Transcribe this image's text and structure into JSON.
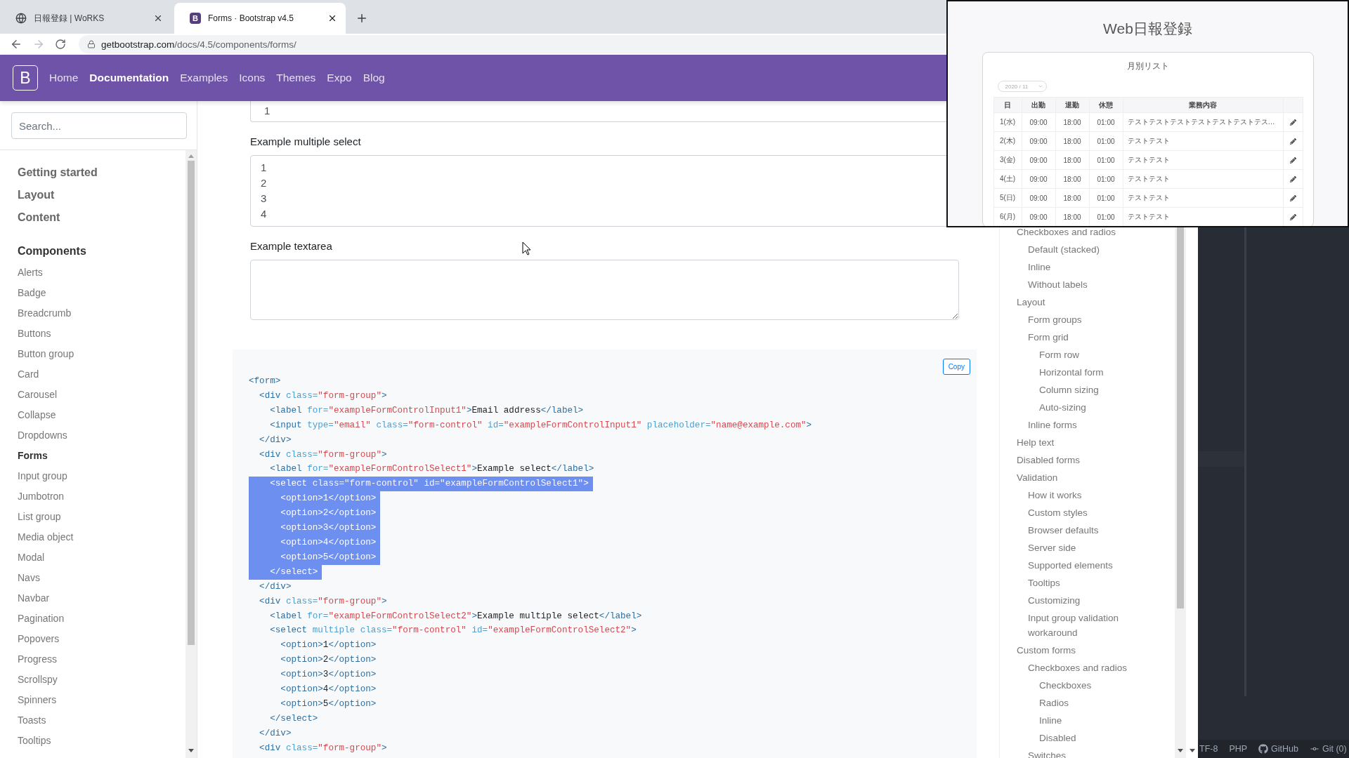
{
  "browser": {
    "tabs": [
      {
        "title": "日報登録 | WoRKS",
        "selected": false,
        "favicon": {
          "kind": "globe"
        }
      },
      {
        "title": "Forms · Bootstrap v4.5",
        "selected": true,
        "favicon": {
          "kind": "brand",
          "letter": "B"
        }
      }
    ],
    "back_disabled": false,
    "forward_disabled": true,
    "url": {
      "host": "getbootstrap.com",
      "path": "/docs/4.5/components/forms/"
    }
  },
  "navbar": {
    "brand": "B",
    "links": [
      {
        "label": "Home",
        "selected": false
      },
      {
        "label": "Documentation",
        "selected": true
      },
      {
        "label": "Examples",
        "selected": false
      },
      {
        "label": "Icons",
        "selected": false
      },
      {
        "label": "Themes",
        "selected": false
      },
      {
        "label": "Expo",
        "selected": false
      },
      {
        "label": "Blog",
        "selected": false
      }
    ]
  },
  "sidebar": {
    "search": {
      "placeholder": "Search..."
    },
    "items": [
      {
        "label": "Getting started",
        "expanded": false
      },
      {
        "label": "Layout",
        "expanded": false
      },
      {
        "label": "Content",
        "expanded": false
      },
      {
        "label": "Components",
        "expanded": true,
        "children": [
          {
            "label": "Alerts",
            "selected": false
          },
          {
            "label": "Badge",
            "selected": false
          },
          {
            "label": "Breadcrumb",
            "selected": false
          },
          {
            "label": "Buttons",
            "selected": false
          },
          {
            "label": "Button group",
            "selected": false
          },
          {
            "label": "Card",
            "selected": false
          },
          {
            "label": "Carousel",
            "selected": false
          },
          {
            "label": "Collapse",
            "selected": false
          },
          {
            "label": "Dropdowns",
            "selected": false
          },
          {
            "label": "Forms",
            "selected": true
          },
          {
            "label": "Input group",
            "selected": false
          },
          {
            "label": "Jumbotron",
            "selected": false
          },
          {
            "label": "List group",
            "selected": false
          },
          {
            "label": "Media object",
            "selected": false
          },
          {
            "label": "Modal",
            "selected": false
          },
          {
            "label": "Navs",
            "selected": false
          },
          {
            "label": "Navbar",
            "selected": false
          },
          {
            "label": "Pagination",
            "selected": false
          },
          {
            "label": "Popovers",
            "selected": false
          },
          {
            "label": "Progress",
            "selected": false
          },
          {
            "label": "Scrollspy",
            "selected": false
          },
          {
            "label": "Spinners",
            "selected": false
          },
          {
            "label": "Toasts",
            "selected": false
          },
          {
            "label": "Tooltips",
            "selected": false
          }
        ]
      }
    ]
  },
  "example": {
    "select": {
      "value": "1"
    },
    "multi_select": {
      "label": "Example multiple select",
      "options": [
        "1",
        "2",
        "3",
        "4"
      ]
    },
    "textarea": {
      "label": "Example textarea"
    }
  },
  "code": {
    "copy_button": "Copy",
    "lines": [
      {
        "selected": false,
        "tokens": [
          {
            "kind": "tag",
            "text": "<form>"
          }
        ]
      },
      {
        "selected": false,
        "tokens": [
          {
            "kind": "tag",
            "text": "  <div "
          },
          {
            "kind": "attr",
            "text": "class="
          },
          {
            "kind": "str",
            "text": "\"form-group\""
          },
          {
            "kind": "tag",
            "text": ">"
          }
        ]
      },
      {
        "selected": false,
        "tokens": [
          {
            "kind": "tag",
            "text": "    <label "
          },
          {
            "kind": "attr",
            "text": "for="
          },
          {
            "kind": "str",
            "text": "\"exampleFormControlInput1\""
          },
          {
            "kind": "tag",
            "text": ">"
          },
          {
            "kind": "text",
            "text": "Email address"
          },
          {
            "kind": "tag",
            "text": "</label>"
          }
        ]
      },
      {
        "selected": false,
        "tokens": [
          {
            "kind": "tag",
            "text": "    <input "
          },
          {
            "kind": "attr",
            "text": "type="
          },
          {
            "kind": "str",
            "text": "\"email\""
          },
          {
            "kind": "attr",
            "text": " class="
          },
          {
            "kind": "str",
            "text": "\"form-control\""
          },
          {
            "kind": "attr",
            "text": " id="
          },
          {
            "kind": "str",
            "text": "\"exampleFormControlInput1\""
          },
          {
            "kind": "attr",
            "text": " placeholder="
          },
          {
            "kind": "str",
            "text": "\"name@example.com\""
          },
          {
            "kind": "tag",
            "text": ">"
          }
        ]
      },
      {
        "selected": false,
        "tokens": [
          {
            "kind": "tag",
            "text": "  </div>"
          }
        ]
      },
      {
        "selected": false,
        "tokens": [
          {
            "kind": "tag",
            "text": "  <div "
          },
          {
            "kind": "attr",
            "text": "class="
          },
          {
            "kind": "str",
            "text": "\"form-group\""
          },
          {
            "kind": "tag",
            "text": ">"
          }
        ]
      },
      {
        "selected": false,
        "tokens": [
          {
            "kind": "tag",
            "text": "    <label "
          },
          {
            "kind": "attr",
            "text": "for="
          },
          {
            "kind": "str",
            "text": "\"exampleFormControlSelect1\""
          },
          {
            "kind": "tag",
            "text": ">"
          },
          {
            "kind": "text",
            "text": "Example select"
          },
          {
            "kind": "tag",
            "text": "</label>"
          }
        ]
      },
      {
        "selected": true,
        "tokens": [
          {
            "kind": "tag",
            "text": "    <select "
          },
          {
            "kind": "attr",
            "text": "class="
          },
          {
            "kind": "str",
            "text": "\"form-control\""
          },
          {
            "kind": "attr",
            "text": " id="
          },
          {
            "kind": "str",
            "text": "\"exampleFormControlSelect1\""
          },
          {
            "kind": "tag",
            "text": ">"
          }
        ]
      },
      {
        "selected": true,
        "tokens": [
          {
            "kind": "tag",
            "text": "      <option>"
          },
          {
            "kind": "text",
            "text": "1"
          },
          {
            "kind": "tag",
            "text": "</option>"
          }
        ]
      },
      {
        "selected": true,
        "tokens": [
          {
            "kind": "tag",
            "text": "      <option>"
          },
          {
            "kind": "text",
            "text": "2"
          },
          {
            "kind": "tag",
            "text": "</option>"
          }
        ]
      },
      {
        "selected": true,
        "tokens": [
          {
            "kind": "tag",
            "text": "      <option>"
          },
          {
            "kind": "text",
            "text": "3"
          },
          {
            "kind": "tag",
            "text": "</option>"
          }
        ]
      },
      {
        "selected": true,
        "tokens": [
          {
            "kind": "tag",
            "text": "      <option>"
          },
          {
            "kind": "text",
            "text": "4"
          },
          {
            "kind": "tag",
            "text": "</option>"
          }
        ]
      },
      {
        "selected": true,
        "tokens": [
          {
            "kind": "tag",
            "text": "      <option>"
          },
          {
            "kind": "text",
            "text": "5"
          },
          {
            "kind": "tag",
            "text": "</option>"
          }
        ]
      },
      {
        "selected": true,
        "tokens": [
          {
            "kind": "tag",
            "text": "    </select>"
          }
        ]
      },
      {
        "selected": false,
        "tokens": [
          {
            "kind": "tag",
            "text": "  </div>"
          }
        ]
      },
      {
        "selected": false,
        "tokens": [
          {
            "kind": "tag",
            "text": "  <div "
          },
          {
            "kind": "attr",
            "text": "class="
          },
          {
            "kind": "str",
            "text": "\"form-group\""
          },
          {
            "kind": "tag",
            "text": ">"
          }
        ]
      },
      {
        "selected": false,
        "tokens": [
          {
            "kind": "tag",
            "text": "    <label "
          },
          {
            "kind": "attr",
            "text": "for="
          },
          {
            "kind": "str",
            "text": "\"exampleFormControlSelect2\""
          },
          {
            "kind": "tag",
            "text": ">"
          },
          {
            "kind": "text",
            "text": "Example multiple select"
          },
          {
            "kind": "tag",
            "text": "</label>"
          }
        ]
      },
      {
        "selected": false,
        "tokens": [
          {
            "kind": "tag",
            "text": "    <select "
          },
          {
            "kind": "attr",
            "text": "multiple class="
          },
          {
            "kind": "str",
            "text": "\"form-control\""
          },
          {
            "kind": "attr",
            "text": " id="
          },
          {
            "kind": "str",
            "text": "\"exampleFormControlSelect2\""
          },
          {
            "kind": "tag",
            "text": ">"
          }
        ]
      },
      {
        "selected": false,
        "tokens": [
          {
            "kind": "tag",
            "text": "      <option>"
          },
          {
            "kind": "text",
            "text": "1"
          },
          {
            "kind": "tag",
            "text": "</option>"
          }
        ]
      },
      {
        "selected": false,
        "tokens": [
          {
            "kind": "tag",
            "text": "      <option>"
          },
          {
            "kind": "text",
            "text": "2"
          },
          {
            "kind": "tag",
            "text": "</option>"
          }
        ]
      },
      {
        "selected": false,
        "tokens": [
          {
            "kind": "tag",
            "text": "      <option>"
          },
          {
            "kind": "text",
            "text": "3"
          },
          {
            "kind": "tag",
            "text": "</option>"
          }
        ]
      },
      {
        "selected": false,
        "tokens": [
          {
            "kind": "tag",
            "text": "      <option>"
          },
          {
            "kind": "text",
            "text": "4"
          },
          {
            "kind": "tag",
            "text": "</option>"
          }
        ]
      },
      {
        "selected": false,
        "tokens": [
          {
            "kind": "tag",
            "text": "      <option>"
          },
          {
            "kind": "text",
            "text": "5"
          },
          {
            "kind": "tag",
            "text": "</option>"
          }
        ]
      },
      {
        "selected": false,
        "tokens": [
          {
            "kind": "tag",
            "text": "    </select>"
          }
        ]
      },
      {
        "selected": false,
        "tokens": [
          {
            "kind": "tag",
            "text": "  </div>"
          }
        ]
      },
      {
        "selected": false,
        "tokens": [
          {
            "kind": "tag",
            "text": "  <div "
          },
          {
            "kind": "attr",
            "text": "class="
          },
          {
            "kind": "str",
            "text": "\"form-group\""
          },
          {
            "kind": "tag",
            "text": ">"
          }
        ]
      }
    ]
  },
  "toc": [
    {
      "label": "Checkboxes and radios",
      "children": [
        {
          "label": "Default (stacked)"
        },
        {
          "label": "Inline"
        },
        {
          "label": "Without labels"
        }
      ]
    },
    {
      "label": "Layout",
      "children": [
        {
          "label": "Form groups"
        },
        {
          "label": "Form grid",
          "children": [
            {
              "label": "Form row"
            },
            {
              "label": "Horizontal form"
            },
            {
              "label": "Column sizing"
            },
            {
              "label": "Auto-sizing"
            }
          ]
        },
        {
          "label": "Inline forms"
        }
      ]
    },
    {
      "label": "Help text"
    },
    {
      "label": "Disabled forms"
    },
    {
      "label": "Validation",
      "children": [
        {
          "label": "How it works"
        },
        {
          "label": "Custom styles"
        },
        {
          "label": "Browser defaults"
        },
        {
          "label": "Server side"
        },
        {
          "label": "Supported elements"
        },
        {
          "label": "Tooltips"
        },
        {
          "label": "Customizing"
        },
        {
          "label": "Input group validation workaround"
        }
      ]
    },
    {
      "label": "Custom forms",
      "children": [
        {
          "label": "Checkboxes and radios",
          "children": [
            {
              "label": "Checkboxes"
            },
            {
              "label": "Radios"
            },
            {
              "label": "Inline"
            },
            {
              "label": "Disabled"
            }
          ]
        },
        {
          "label": "Switches"
        }
      ]
    }
  ],
  "editor_status_bar": [
    {
      "kind": "text",
      "label": "TF-8"
    },
    {
      "kind": "text",
      "label": "PHP"
    },
    {
      "kind": "github",
      "label": "GitHub"
    },
    {
      "kind": "git",
      "label": "Git (0)"
    }
  ],
  "overlay_window": {
    "title": "Web日報登録",
    "card_title": "月別リスト",
    "month_select": "2020 / 11",
    "columns": [
      "日",
      "出勤",
      "退勤",
      "休憩",
      "業務内容"
    ],
    "rows": [
      {
        "cells": [
          "1(水)",
          "09:00",
          "18:00",
          "01:00",
          "テストテストテストテストテストテストテス…"
        ]
      },
      {
        "cells": [
          "2(木)",
          "09:00",
          "18:00",
          "01:00",
          "テストテスト"
        ]
      },
      {
        "cells": [
          "3(金)",
          "09:00",
          "18:00",
          "01:00",
          "テストテスト"
        ]
      },
      {
        "cells": [
          "4(土)",
          "09:00",
          "18:00",
          "01:00",
          "テストテスト"
        ]
      },
      {
        "cells": [
          "5(日)",
          "09:00",
          "18:00",
          "01:00",
          "テストテスト"
        ]
      },
      {
        "cells": [
          "6(月)",
          "09:00",
          "18:00",
          "01:00",
          "テストテスト"
        ]
      }
    ]
  }
}
